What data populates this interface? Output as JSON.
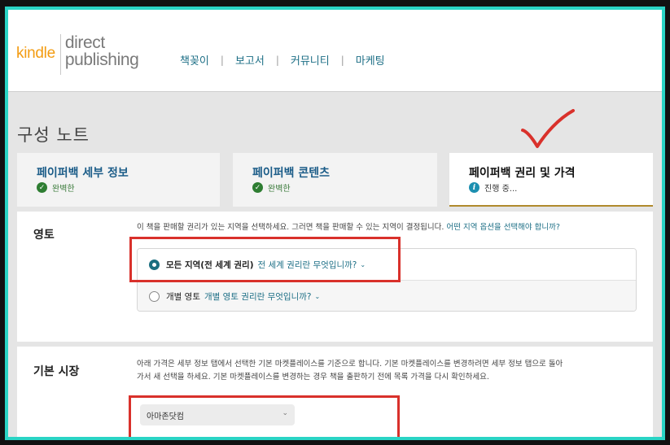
{
  "header": {
    "logo_kindle": "kindle",
    "logo_direct": "direct",
    "logo_publishing": "publishing",
    "nav": [
      "책꽂이",
      "보고서",
      "커뮤니티",
      "마케팅"
    ]
  },
  "page_title": "구성 노트",
  "tabs": [
    {
      "title": "페이퍼백 세부 정보",
      "status": "완벽한",
      "status_icon": "check-circle-icon"
    },
    {
      "title": "페이퍼백 콘텐츠",
      "status": "완벽한",
      "status_icon": "check-circle-icon"
    },
    {
      "title": "페이퍼백 권리 및 가격",
      "status": "진행 중...",
      "status_icon": "info-icon"
    }
  ],
  "territory": {
    "label": "영토",
    "description": "이 책을 판매할 권리가 있는 지역을 선택하세요. 그러면 책을 판매할 수 있는 지역이 결정됩니다.",
    "description_link": "어떤 지역 옵션을 선택해야 합니까?",
    "options": [
      {
        "label": "모든 지역(전 세계 권리)",
        "link": "전 세계 권리란 무엇입니까?",
        "selected": true
      },
      {
        "label": "개별 영토",
        "link": "개별 영토 권리란 무엇입니까?",
        "selected": false
      }
    ]
  },
  "marketplace": {
    "label": "기본 시장",
    "description_line1": "아래 가격은 세부 정보 탭에서 선택한 기본 마켓플레이스를 기준으로 합니다. 기본 마켓플레이스를 변경하려면 세부 정보 탭으로 돌아",
    "description_line2": "가서 새 선택을 하세요. 기본 마켓플레이스를 변경하는 경우 책을 출판하기 전에 목록 가격을 다시 확인하세요.",
    "select_value": "아마존닷컴"
  },
  "colors": {
    "frame": "#2ad4c5",
    "link": "#1d6f86",
    "logo_orange": "#f39c12",
    "highlight_red": "#d9312b",
    "check_green": "#2e7d32"
  }
}
